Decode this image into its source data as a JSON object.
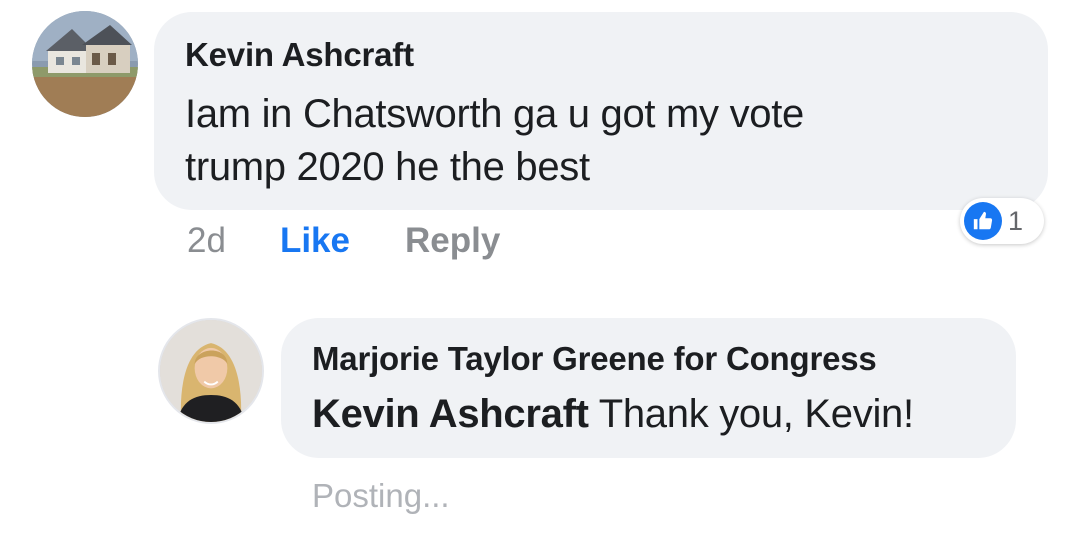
{
  "comment": {
    "author": "Kevin Ashcraft",
    "text_line1": "Iam in Chatsworth ga u got my vote",
    "text_line2": "trump 2020 he the best",
    "time": "2d",
    "like_label": "Like",
    "reply_label": "Reply",
    "reaction_count": "1",
    "reaction_icon": "thumbs-up-icon",
    "avatar_icon": "house-photo"
  },
  "reply": {
    "author": "Marjorie Taylor Greene for Congress",
    "mention": "Kevin Ashcraft",
    "text": " Thank you, Kevin!",
    "status": "Posting...",
    "avatar_icon": "person-photo"
  },
  "colors": {
    "bubble_bg": "#f0f2f5",
    "accent": "#1877f2",
    "secondary_text": "#8a8d91",
    "primary_text": "#1c1e21"
  }
}
